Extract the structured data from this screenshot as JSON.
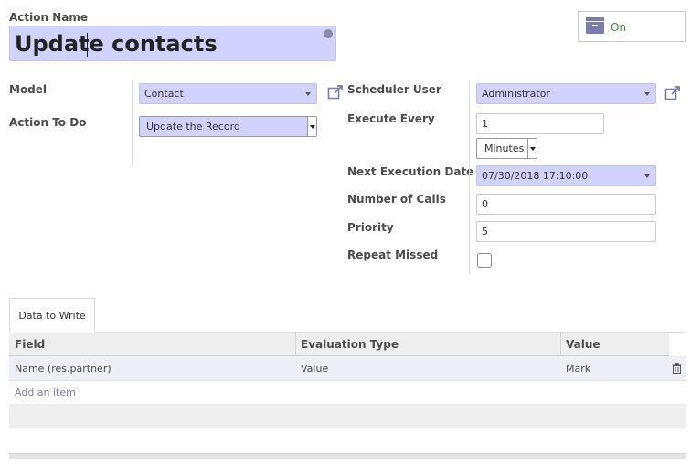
{
  "action_name": {
    "label": "Action Name",
    "value": "Update contacts"
  },
  "active_toggle": {
    "label": "On"
  },
  "model": {
    "label": "Model",
    "value": "Contact"
  },
  "action_to_do": {
    "label": "Action To Do",
    "value": "Update the Record"
  },
  "scheduler_user": {
    "label": "Scheduler User",
    "value": "Administrator"
  },
  "execute_every": {
    "label": "Execute Every",
    "value": "1",
    "unit": "Minutes"
  },
  "next_execution": {
    "label": "Next Execution Date",
    "value": "07/30/2018 17:10:00"
  },
  "number_of_calls": {
    "label": "Number of Calls",
    "value": "0"
  },
  "priority": {
    "label": "Priority",
    "value": "5"
  },
  "repeat_missed": {
    "label": "Repeat Missed",
    "checked": false
  },
  "tabs": [
    {
      "label": "Data to Write"
    }
  ],
  "table": {
    "headers": [
      "Field",
      "Evaluation Type",
      "Value"
    ],
    "rows": [
      {
        "field": "Name (res.partner)",
        "eval_type": "Value",
        "value": "Mark"
      }
    ],
    "add_item": "Add an item"
  },
  "colors": {
    "accent": "#7c7bad",
    "required_bg": "#d2d2ff",
    "toggle_green": "#3e8e3e"
  }
}
